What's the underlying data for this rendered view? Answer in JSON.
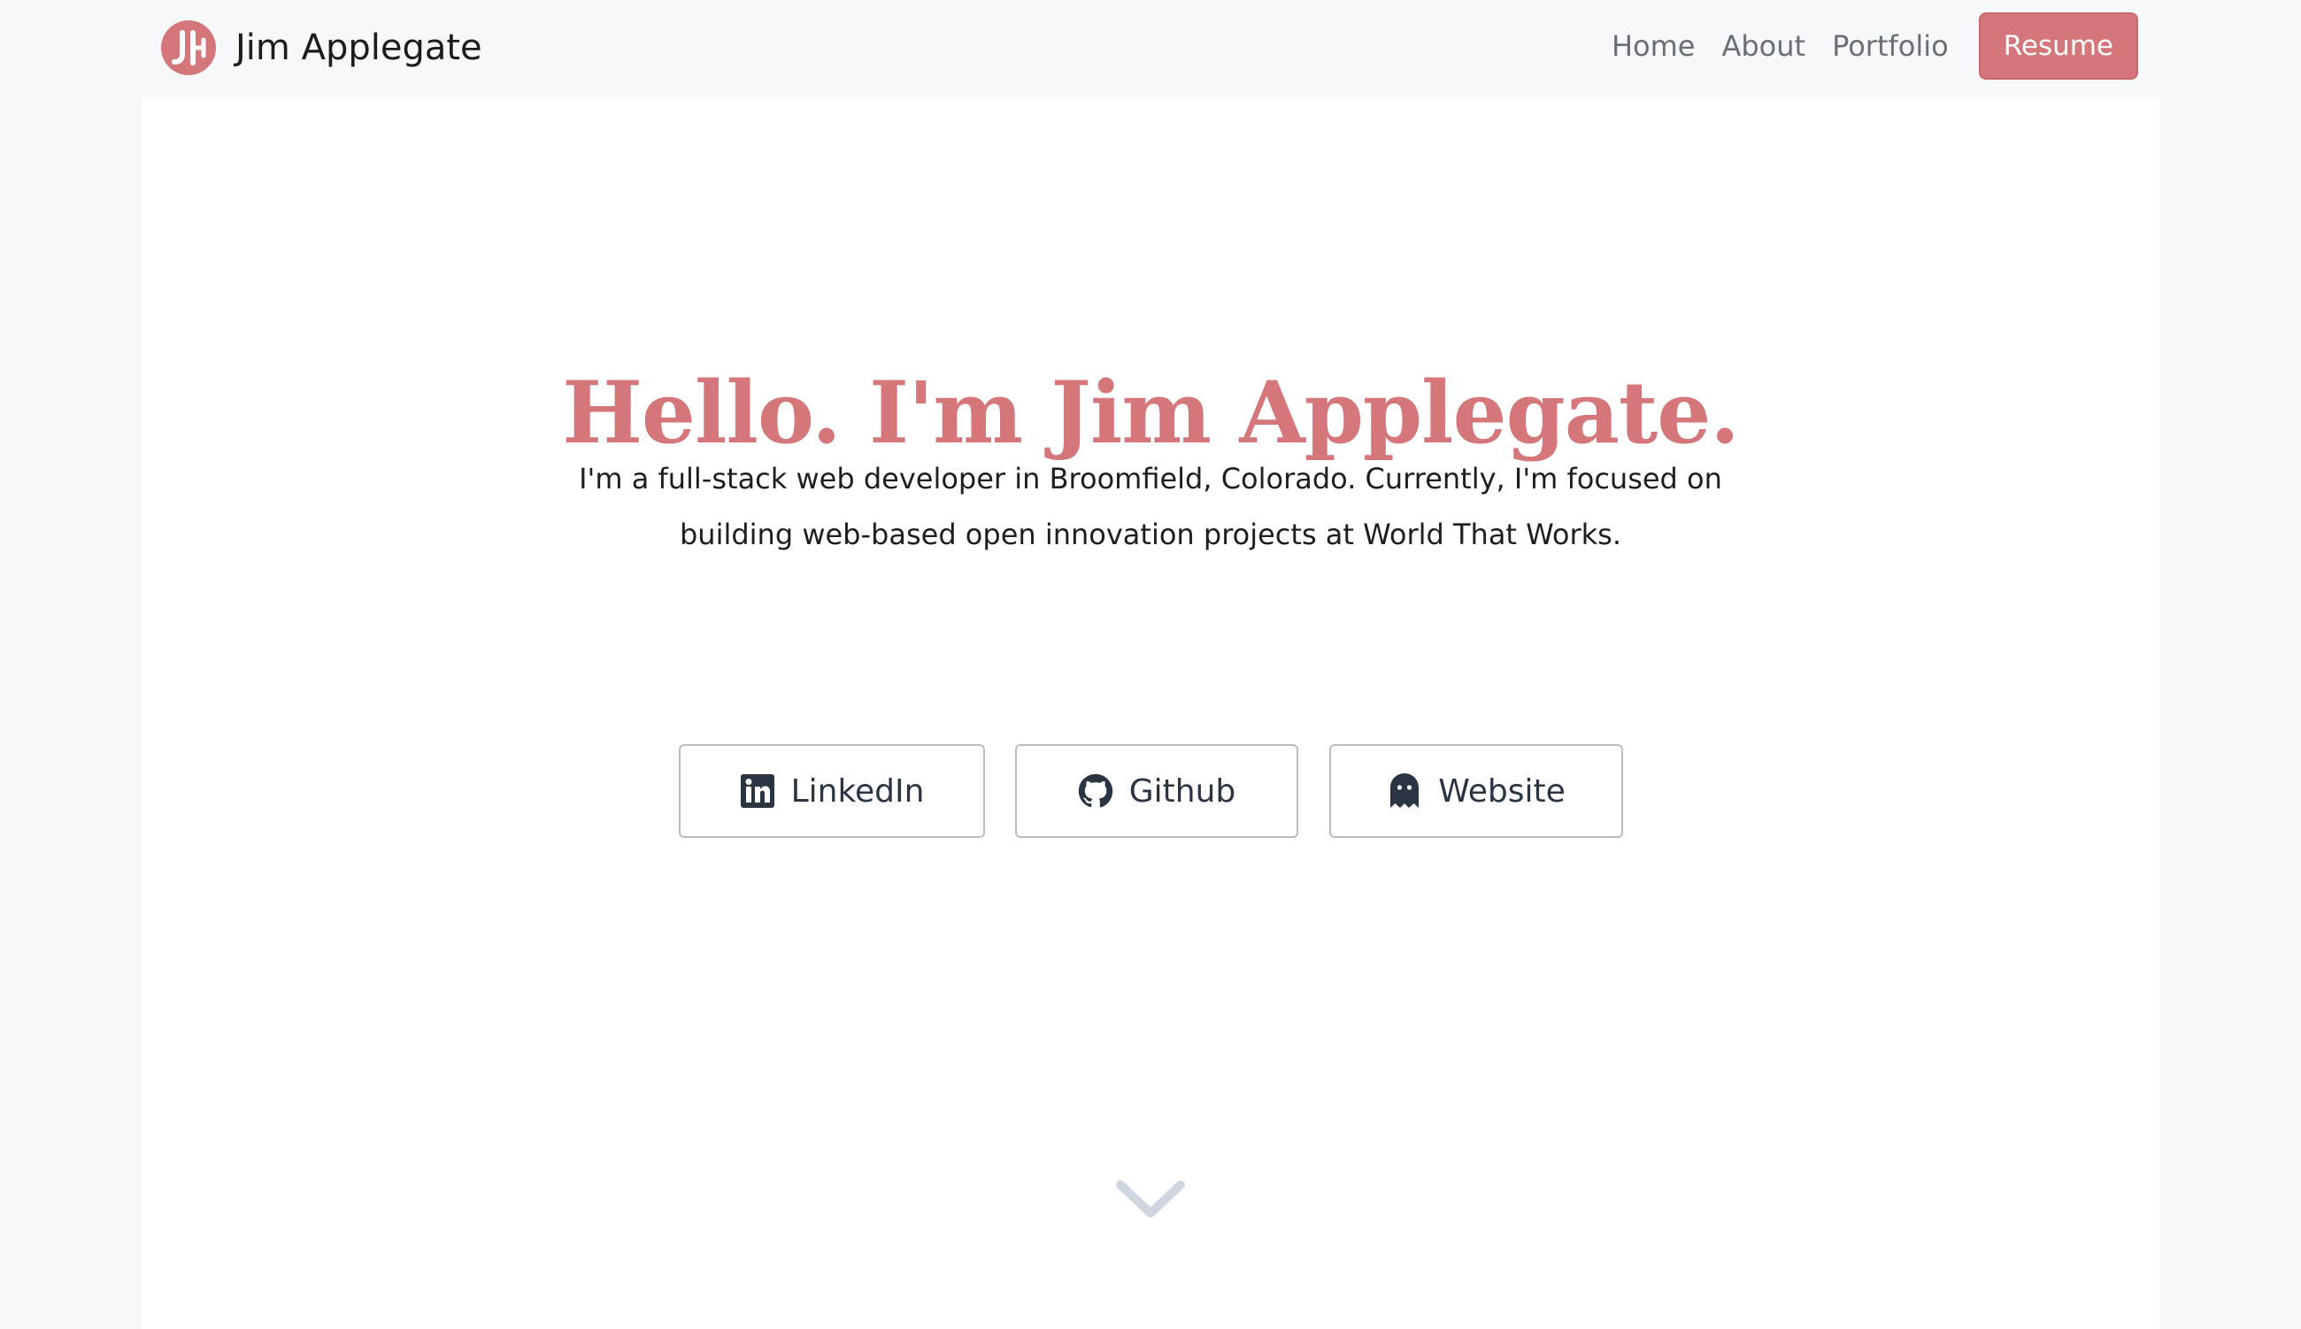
{
  "brand": {
    "name": "Jim Applegate",
    "logo_icon": "ja-monogram-logo",
    "logo_color": "#d4767a"
  },
  "nav": {
    "items": [
      {
        "label": "Home"
      },
      {
        "label": "About"
      },
      {
        "label": "Portfolio"
      }
    ],
    "resume_label": "Resume"
  },
  "hero": {
    "title": "Hello. I'm Jim Applegate.",
    "subtitle": "I'm a full-stack web developer in Broomfield, Colorado. Currently, I'm focused on building web-based open innovation projects at World That Works."
  },
  "social": [
    {
      "label": "LinkedIn",
      "icon": "linkedin-icon"
    },
    {
      "label": "Github",
      "icon": "github-icon"
    },
    {
      "label": "Website",
      "icon": "ghost-icon"
    }
  ],
  "scroll": {
    "icon": "chevron-down-icon"
  },
  "colors": {
    "accent": "#d4767a",
    "page_background": "#f7f8fa",
    "panel_background": "#ffffff",
    "social_text": "#2a3442",
    "nav_text": "#6a6f75",
    "chevron": "#cfd6e0"
  }
}
